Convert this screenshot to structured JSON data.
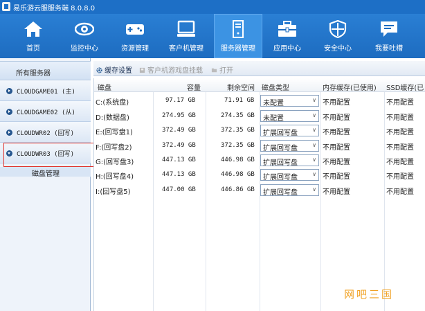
{
  "window": {
    "title": "易乐游云服服务端 8.0.8.0"
  },
  "nav": [
    {
      "label": "首页",
      "icon": "home-icon"
    },
    {
      "label": "监控中心",
      "icon": "eye-icon"
    },
    {
      "label": "资源管理",
      "icon": "gamepad-icon"
    },
    {
      "label": "客户机管理",
      "icon": "monitor-icon"
    },
    {
      "label": "服务器管理",
      "icon": "server-icon",
      "active": true
    },
    {
      "label": "应用中心",
      "icon": "toolbox-icon"
    },
    {
      "label": "安全中心",
      "icon": "shield-icon"
    },
    {
      "label": "我要吐槽",
      "icon": "chat-icon"
    }
  ],
  "left": {
    "header": "所有服务器",
    "servers": [
      {
        "name": "CLOUDGAME01 (主)"
      },
      {
        "name": "CLOUDGAME02 (从)"
      },
      {
        "name": "CLOUDWR02 (回写)"
      },
      {
        "name": "CLOUDWR03 (回写)"
      }
    ],
    "sub_item": "磁盘管理"
  },
  "toolbar": {
    "cache_settings": "缓存设置",
    "mount_disk": "客户机游戏盘挂载",
    "open": "打开"
  },
  "grid": {
    "columns": [
      "磁盘",
      "容量",
      "剩余空间",
      "磁盘类型",
      "内存缓存(已使用)",
      "SSD缓存(已"
    ],
    "rows": [
      {
        "disk": "C:(系统盘)",
        "capacity": "97.17 GB",
        "free": "71.91 GB",
        "type": "未配置",
        "mem": "不用配置",
        "ssd": "不用配置"
      },
      {
        "disk": "D:(数据盘)",
        "capacity": "274.95 GB",
        "free": "274.35 GB",
        "type": "未配置",
        "mem": "不用配置",
        "ssd": "不用配置"
      },
      {
        "disk": "E:(回写盘1)",
        "capacity": "372.49 GB",
        "free": "372.35 GB",
        "type": "扩展回写盘",
        "mem": "不用配置",
        "ssd": "不用配置"
      },
      {
        "disk": "F:(回写盘2)",
        "capacity": "372.49 GB",
        "free": "372.35 GB",
        "type": "扩展回写盘",
        "mem": "不用配置",
        "ssd": "不用配置"
      },
      {
        "disk": "G:(回写盘3)",
        "capacity": "447.13 GB",
        "free": "446.98 GB",
        "type": "扩展回写盘",
        "mem": "不用配置",
        "ssd": "不用配置"
      },
      {
        "disk": "H:(回写盘4)",
        "capacity": "447.13 GB",
        "free": "446.98 GB",
        "type": "扩展回写盘",
        "mem": "不用配置",
        "ssd": "不用配置"
      },
      {
        "disk": "I:(回写盘5)",
        "capacity": "447.00 GB",
        "free": "446.86 GB",
        "type": "扩展回写盘",
        "mem": "不用配置",
        "ssd": "不用配置"
      }
    ]
  },
  "watermark": "网吧三国"
}
